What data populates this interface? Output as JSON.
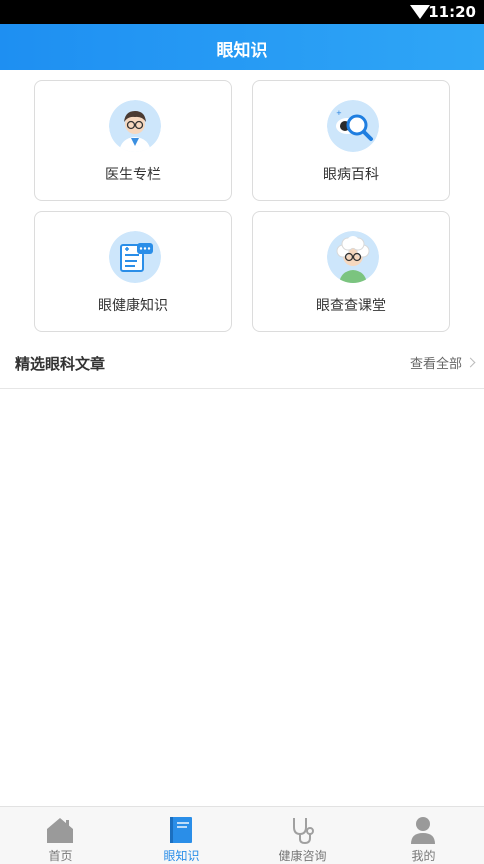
{
  "status_bar": {
    "time": "11:20"
  },
  "header": {
    "title": "眼知识"
  },
  "cards": [
    {
      "label": "医生专栏",
      "icon": "doctor-icon"
    },
    {
      "label": "眼病百科",
      "icon": "eye-search-icon"
    },
    {
      "label": "眼健康知识",
      "icon": "health-note-icon"
    },
    {
      "label": "眼查查课堂",
      "icon": "elder-glasses-icon"
    }
  ],
  "section": {
    "title": "精选眼科文章",
    "more": "查看全部"
  },
  "tabbar": {
    "items": [
      {
        "label": "首页",
        "icon": "home-icon"
      },
      {
        "label": "眼知识",
        "icon": "book-icon",
        "active": true
      },
      {
        "label": "健康咨询",
        "icon": "stethoscope-icon"
      },
      {
        "label": "我的",
        "icon": "user-icon"
      }
    ]
  },
  "colors": {
    "accent": "#2a8ee8",
    "header": "#1e8ff2"
  }
}
